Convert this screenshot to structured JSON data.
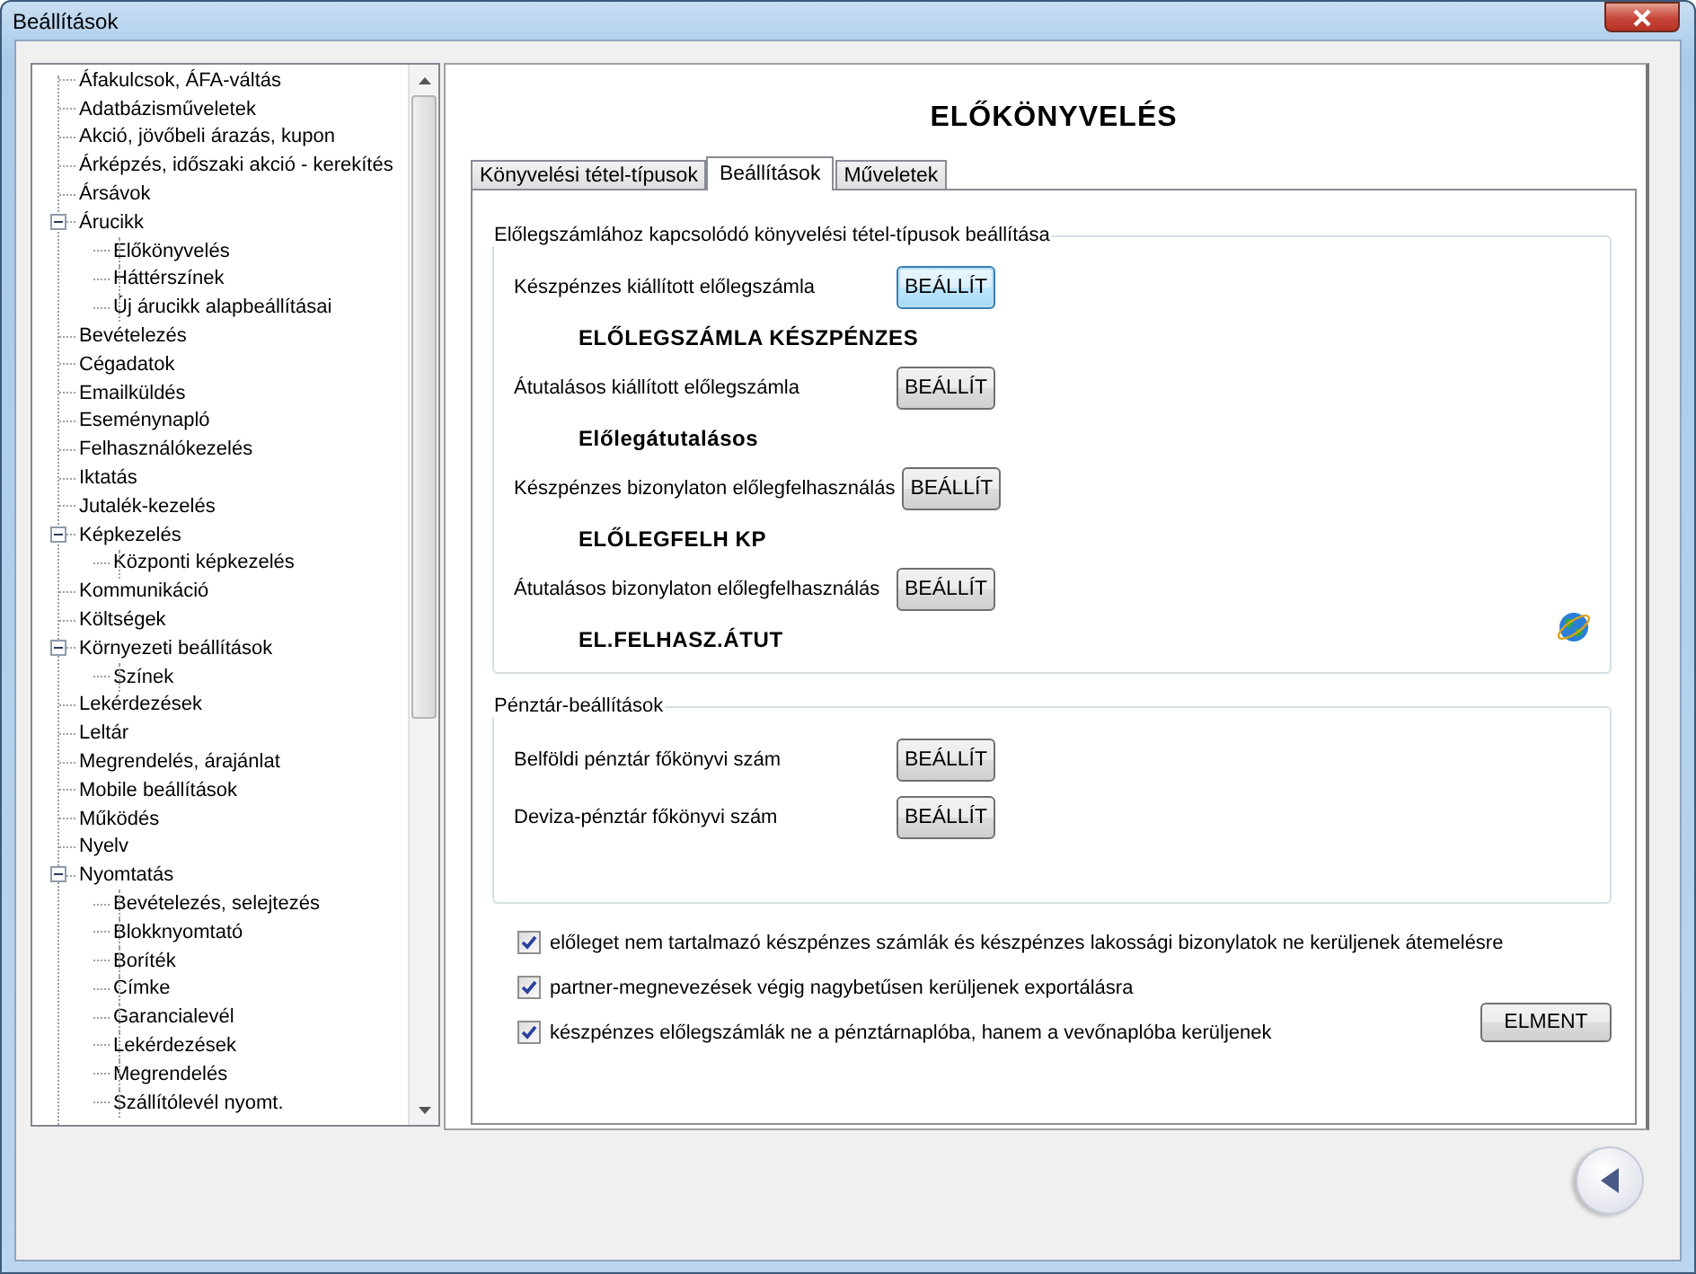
{
  "window": {
    "title": "Beállítások"
  },
  "tree": {
    "items": [
      {
        "label": "Áfakulcsok, ÁFA-váltás"
      },
      {
        "label": "Adatbázisműveletek"
      },
      {
        "label": "Akció, jövőbeli árazás, kupon"
      },
      {
        "label": "Árképzés, időszaki akció - kerekítés"
      },
      {
        "label": "Ársávok"
      },
      {
        "label": "Árucikk",
        "expanded": true,
        "children": [
          {
            "label": "Előkönyvelés"
          },
          {
            "label": "Háttérszínek"
          },
          {
            "label": "Új árucikk alapbeállításai"
          }
        ]
      },
      {
        "label": "Bevételezés"
      },
      {
        "label": "Cégadatok"
      },
      {
        "label": "Emailküldés"
      },
      {
        "label": "Eseménynapló"
      },
      {
        "label": "Felhasználókezelés"
      },
      {
        "label": "Iktatás"
      },
      {
        "label": "Jutalék-kezelés"
      },
      {
        "label": "Képkezelés",
        "expanded": true,
        "children": [
          {
            "label": "Központi képkezelés"
          }
        ]
      },
      {
        "label": "Kommunikáció"
      },
      {
        "label": "Költségek"
      },
      {
        "label": "Környezeti beállítások",
        "expanded": true,
        "children": [
          {
            "label": "Színek"
          }
        ]
      },
      {
        "label": "Lekérdezések"
      },
      {
        "label": "Leltár"
      },
      {
        "label": "Megrendelés, árajánlat"
      },
      {
        "label": "Mobile beállítások"
      },
      {
        "label": "Működés"
      },
      {
        "label": "Nyelv"
      },
      {
        "label": "Nyomtatás",
        "expanded": true,
        "children": [
          {
            "label": "Bevételezés, selejtezés"
          },
          {
            "label": "Blokknyomtató"
          },
          {
            "label": "Boríték"
          },
          {
            "label": "Címke"
          },
          {
            "label": "Garancialevél"
          },
          {
            "label": "Lekérdezések"
          },
          {
            "label": "Megrendelés"
          },
          {
            "label": "Szállítólevél nyomt."
          }
        ]
      }
    ]
  },
  "heading": "ELŐKÖNYVELÉS",
  "tabs": [
    {
      "label": "Könyvelési tétel-típusok",
      "selected": false
    },
    {
      "label": "Beállítások",
      "selected": true
    },
    {
      "label": "Műveletek",
      "selected": false
    }
  ],
  "advance_group": {
    "title": "Előlegszámlához kapcsolódó könyvelési tétel-típusok beállítása",
    "rows": [
      {
        "label": "Készpénzes kiállított előlegszámla",
        "button": "BEÁLLÍT",
        "focused": true,
        "value": "ELŐLEGSZÁMLA KÉSZPÉNZES"
      },
      {
        "label": "Átutalásos kiállított előlegszámla",
        "button": "BEÁLLÍT",
        "focused": false,
        "value": "Előlegátutalásos"
      },
      {
        "label": "Készpénzes bizonylaton előlegfelhasználás",
        "button": "BEÁLLÍT",
        "focused": false,
        "value": "ELŐLEGFELH KP"
      },
      {
        "label": "Átutalásos bizonylaton előlegfelhasználás",
        "button": "BEÁLLÍT",
        "focused": false,
        "value": "EL.FELHASZ.ÁTUT"
      }
    ]
  },
  "cash_group": {
    "title": "Pénztár-beállítások",
    "rows": [
      {
        "label": "Belföldi pénztár főkönyvi szám",
        "button": "BEÁLLÍT"
      },
      {
        "label": "Deviza-pénztár főkönyvi szám",
        "button": "BEÁLLÍT"
      }
    ]
  },
  "options": [
    {
      "label": "előleget nem tartalmazó készpénzes számlák és készpénzes lakossági bizonylatok ne kerüljenek átemelésre",
      "checked": true
    },
    {
      "label": "partner-megnevezések végig nagybetűsen kerüljenek exportálásra",
      "checked": true
    },
    {
      "label": "készpénzes előlegszámlák ne a pénztárnaplóba, hanem a vevőnaplóba kerüljenek",
      "checked": true
    }
  ],
  "save_button": "ELMENT"
}
